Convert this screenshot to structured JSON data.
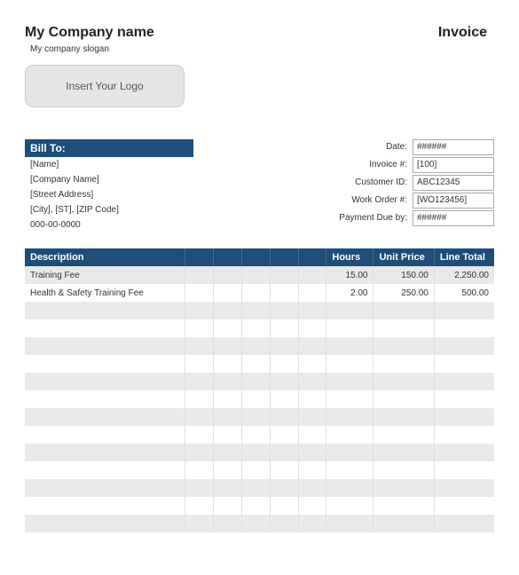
{
  "header": {
    "company_name": "My Company name",
    "company_slogan": "My company slogan",
    "invoice_title": "Invoice",
    "logo_placeholder": "Insert Your Logo"
  },
  "bill_to": {
    "header": "Bill To:",
    "name": "[Name]",
    "company": "[Company Name]",
    "street": "[Street Address]",
    "city_st_zip": "[City], [ST], [ZIP Code]",
    "phone": "000-00-0000"
  },
  "meta": {
    "labels": {
      "date": "Date:",
      "invoice_no": "Invoice #:",
      "customer_id": "Customer ID:",
      "work_order": "Work Order #:",
      "payment_due": "Payment Due by:"
    },
    "values": {
      "date": "######",
      "invoice_no": "[100]",
      "customer_id": "ABC12345",
      "work_order": "[WO123456]",
      "payment_due": "######"
    }
  },
  "table": {
    "headers": {
      "description": "Description",
      "hours": "Hours",
      "unit_price": "Unit Price",
      "line_total": "Line Total"
    },
    "rows": [
      {
        "description": "Training Fee",
        "hours": "15.00",
        "unit_price": "150.00",
        "line_total": "2,250.00"
      },
      {
        "description": "Health & Safety Training Fee",
        "hours": "2.00",
        "unit_price": "250.00",
        "line_total": "500.00"
      },
      {
        "description": "",
        "hours": "",
        "unit_price": "",
        "line_total": ""
      },
      {
        "description": "",
        "hours": "",
        "unit_price": "",
        "line_total": ""
      },
      {
        "description": "",
        "hours": "",
        "unit_price": "",
        "line_total": ""
      },
      {
        "description": "",
        "hours": "",
        "unit_price": "",
        "line_total": ""
      },
      {
        "description": "",
        "hours": "",
        "unit_price": "",
        "line_total": ""
      },
      {
        "description": "",
        "hours": "",
        "unit_price": "",
        "line_total": ""
      },
      {
        "description": "",
        "hours": "",
        "unit_price": "",
        "line_total": ""
      },
      {
        "description": "",
        "hours": "",
        "unit_price": "",
        "line_total": ""
      },
      {
        "description": "",
        "hours": "",
        "unit_price": "",
        "line_total": ""
      },
      {
        "description": "",
        "hours": "",
        "unit_price": "",
        "line_total": ""
      },
      {
        "description": "",
        "hours": "",
        "unit_price": "",
        "line_total": ""
      },
      {
        "description": "",
        "hours": "",
        "unit_price": "",
        "line_total": ""
      },
      {
        "description": "",
        "hours": "",
        "unit_price": "",
        "line_total": ""
      }
    ]
  }
}
